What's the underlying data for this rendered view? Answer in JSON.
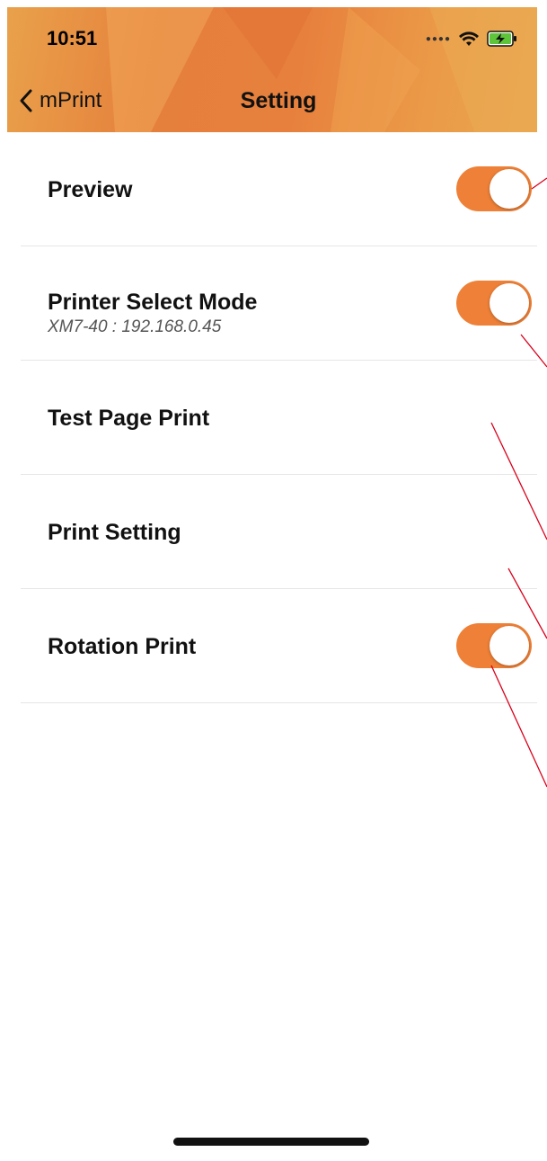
{
  "status_bar": {
    "time": "10:51"
  },
  "nav": {
    "back_label": "mPrint",
    "title": "Setting"
  },
  "settings": [
    {
      "label": "Preview",
      "sublabel": "",
      "toggle": true,
      "on": true
    },
    {
      "label": "Printer Select Mode",
      "sublabel": "XM7-40 : 192.168.0.45",
      "toggle": true,
      "on": true
    },
    {
      "label": "Test Page Print",
      "sublabel": "",
      "toggle": false
    },
    {
      "label": "Print Setting",
      "sublabel": "",
      "toggle": false
    },
    {
      "label": "Rotation Print",
      "sublabel": "",
      "toggle": true,
      "on": true
    }
  ],
  "colors": {
    "accent": "#ee8037",
    "header_orange": "#e57f3c",
    "annotation_red": "#d9001b"
  }
}
